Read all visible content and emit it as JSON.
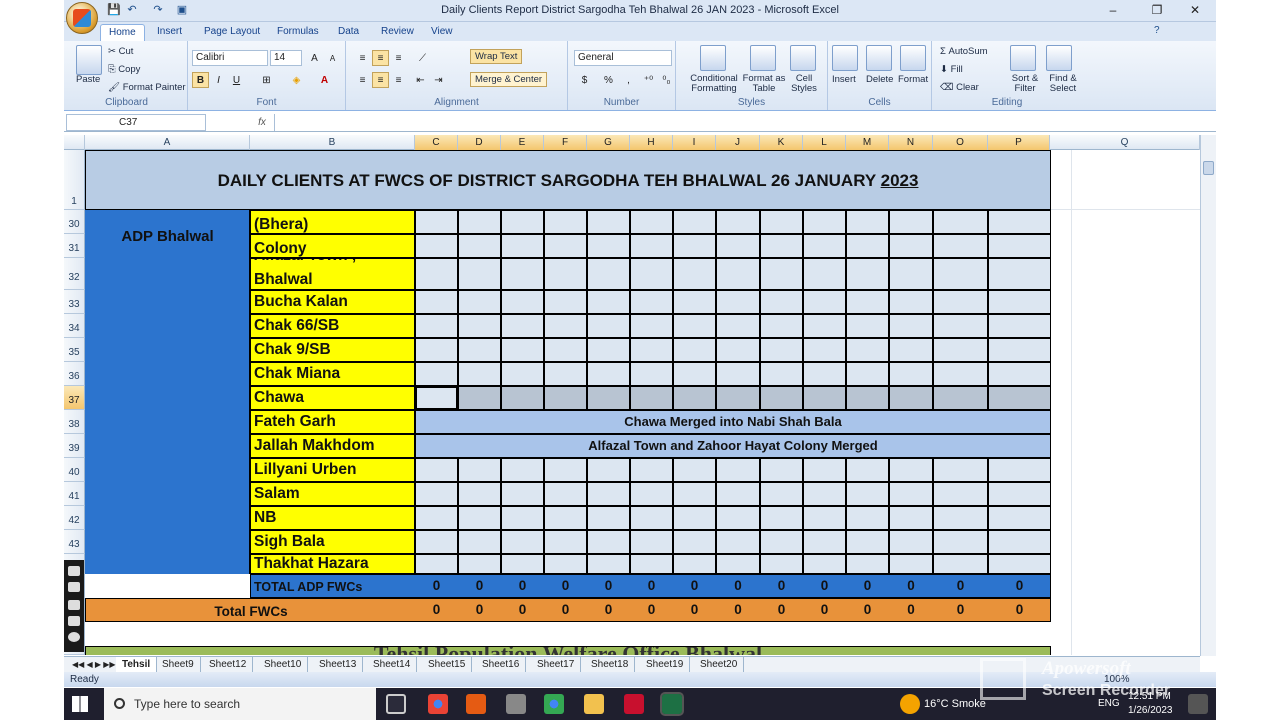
{
  "window": {
    "title": "Daily Clients Report District Sargodha Teh Bhalwal  26 JAN 2023 - Microsoft Excel",
    "controls": {
      "minimize": "–",
      "restore": "❐",
      "close": "✕"
    }
  },
  "ribbon_tabs": [
    "Home",
    "Insert",
    "Page Layout",
    "Formulas",
    "Data",
    "Review",
    "View"
  ],
  "clipboard": {
    "paste": "Paste",
    "cut": "Cut",
    "copy": "Copy",
    "format_painter": "Format Painter",
    "label": "Clipboard"
  },
  "font": {
    "name": "Calibri",
    "size": "14",
    "bold": "B",
    "italic": "I",
    "underline": "U",
    "label": "Font"
  },
  "alignment": {
    "wrap_text": "Wrap Text",
    "merge_center": "Merge & Center",
    "label": "Alignment"
  },
  "number": {
    "format": "General",
    "currency": "$",
    "percent": "%",
    "comma": ",",
    "label": "Number"
  },
  "styles": {
    "conditional": "Conditional Formatting",
    "format_table": "Format as Table",
    "cell_styles": "Cell Styles",
    "label": "Styles"
  },
  "cells": {
    "insert": "Insert",
    "delete": "Delete",
    "format": "Format",
    "label": "Cells"
  },
  "editing": {
    "autosum": "AutoSum",
    "fill": "Fill",
    "clear": "Clear",
    "sort_filter": "Sort & Filter",
    "find_select": "Find & Select",
    "label": "Editing"
  },
  "formula_bar": {
    "name_box": "C37",
    "fx": "fx",
    "formula": ""
  },
  "columns": [
    "A",
    "B",
    "C",
    "D",
    "E",
    "F",
    "G",
    "H",
    "I",
    "J",
    "K",
    "L",
    "M",
    "N",
    "O",
    "P",
    "Q"
  ],
  "selected_column": "C",
  "rows": [
    "1",
    "30",
    "31",
    "32",
    "33",
    "34",
    "35",
    "36",
    "37",
    "38",
    "39",
    "40",
    "41",
    "42",
    "43",
    "",
    "",
    ""
  ],
  "selected_row": "37",
  "sheet": {
    "title_text": "DAILY CLIENTS AT FWCS OF DISTRICT SARGODHA TEH BHALWAL 26 JANUARY ",
    "title_year": "2023",
    "adp_label": "ADP Bhalwal",
    "locations": [
      "(Bhera)",
      "Colony",
      "Bhalwal",
      "Bucha Kalan",
      "Chak 66/SB",
      "Chak 9/SB",
      "Chak Miana",
      "Chawa",
      "Fateh Garh",
      "Jallah Makhdom",
      "Lillyani Urben",
      "Salam",
      "NB",
      "Sigh Bala",
      "Thakhat Hazara"
    ],
    "location_partial_above": [
      "",
      "",
      "Alfazal Town ,",
      "",
      "",
      "",
      "",
      "",
      "",
      "",
      "",
      "",
      "",
      "",
      ""
    ],
    "merged_notes": {
      "row38": "Chawa Merged into Nabi Shah Bala",
      "row39": "Alfazal Town and Zahoor Hayat Colony Merged"
    },
    "total_adp_label": "TOTAL ADP FWCs",
    "total_adp_values": [
      "0",
      "0",
      "0",
      "0",
      "0",
      "0",
      "0",
      "0",
      "0",
      "0",
      "0",
      "0",
      "0",
      "0"
    ],
    "total_fwcs_label": "Total FWCs",
    "total_fwcs_values": [
      "0",
      "0",
      "0",
      "0",
      "0",
      "0",
      "0",
      "0",
      "0",
      "0",
      "0",
      "0",
      "0",
      "0"
    ],
    "next_section_partial": "Tehsil Population Welfare Office Bhalwal"
  },
  "sheet_tabs": [
    "Tehsil",
    "Sheet9",
    "Sheet12",
    "Sheet10",
    "Sheet13",
    "Sheet14",
    "Sheet15",
    "Sheet16",
    "Sheet17",
    "Sheet18",
    "Sheet19",
    "Sheet20"
  ],
  "active_sheet": "Tehsil",
  "status": {
    "ready": "Ready",
    "zoom": "100%"
  },
  "taskbar": {
    "search_placeholder": "Type here to search",
    "weather": "16°C  Smoke",
    "lang": "ENG",
    "time": "12:51 PM",
    "date": "1/26/2023"
  },
  "watermark": {
    "line1": "Apowersoft",
    "line2": "Screen Recorder"
  },
  "colors": {
    "title_fill": "#b8cce4",
    "adp_fill": "#2c74ce",
    "location_fill": "#ffff00",
    "data_fill": "#dce6f1",
    "total_adp_fill": "#2c74ce",
    "total_fwcs_fill": "#e8923a",
    "merge_note_fill": "#a9c4ea"
  }
}
